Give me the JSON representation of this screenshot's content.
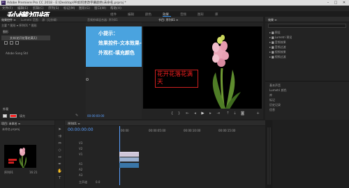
{
  "window": {
    "title": "Adobe Premiere Pro CC 2018 - E:\\Desktop\\PR如何更改字幕颜色\\未命名.prproj *",
    "logo": "Pr",
    "controls": [
      "–",
      "□",
      "✕"
    ]
  },
  "watermark": {
    "text": "秒懂视频"
  },
  "menu": [
    "文件(F)",
    "编辑(E)",
    "剪辑(C)",
    "序列(S)",
    "标记(M)",
    "图形(G)",
    "窗口(W)",
    "帮助(H)"
  ],
  "workspaces": [
    "组件",
    "编辑",
    "颜色",
    "效果",
    "音频",
    "图形",
    "库"
  ],
  "active_workspace": "效果",
  "effect_controls": {
    "tabs": [
      "效果控件 ≡",
      "Lumetri 范围",
      "源: (无剪辑)",
      "音频剪辑混合器: 序列01"
    ],
    "header": "主要 * 图形 ▾ 序列01 * 图形",
    "section_title": "图形",
    "item_text": "文本(花开花落花满天)",
    "font_label": "Adobe Song Std",
    "appearance_label": "外观",
    "fill_label": "填充",
    "stroke_label": "描边",
    "shadow_label": "阴影",
    "fill_color": "#ff2020",
    "timecode": "00:00:00:00"
  },
  "tooltip": {
    "line1": "小提示：",
    "line2": "效果控件-文本效果-",
    "line3": "外观栏-填充颜色"
  },
  "program_monitor": {
    "tab": "节目: 序列01 ≡",
    "title_text": "花开花落花满天",
    "timecode_left": "00:00:00:00",
    "timecode_right": "00:00:16:21",
    "fit_label": "适合",
    "ratio_label": "完整"
  },
  "effects_panel": {
    "tabs": [
      "效果 ≡",
      "媒体浏览器",
      "库",
      "信息",
      "标记"
    ],
    "search_placeholder": "",
    "items": [
      "预设",
      "Lumetri 预设",
      "音频效果",
      "音频过渡",
      "视频效果",
      "视频过渡"
    ],
    "bottom_items": [
      "基本声音",
      "Lumetri 颜色",
      "库",
      "标记",
      "历史记录",
      "信息"
    ]
  },
  "project_panel": {
    "tabs": [
      "项目: 未命名 ≡",
      "媒体浏览器"
    ],
    "project_name": "未命名.prproj",
    "clip_label": "序列01",
    "clip_duration": "16:21"
  },
  "timeline": {
    "tab": "序列01 ≡",
    "timecode": "00:00:00:00",
    "ruler_marks": [
      "00:00",
      "00:00:05:00",
      "00:00:10:00",
      "00:00:15:00"
    ],
    "tracks": [
      {
        "name": "V3"
      },
      {
        "name": "V2"
      },
      {
        "name": "V1"
      },
      {
        "name": "A1"
      },
      {
        "name": "A2"
      },
      {
        "name": "A3"
      }
    ],
    "master_label": "主声道",
    "master_value": "0.0"
  },
  "colors": {
    "accent": "#2d8ceb",
    "tooltip_bg": "#4aa3df",
    "program_blue": "#5aa0ff",
    "clip_video": "#9ab0d0",
    "clip_audio": "#3a76a8"
  }
}
